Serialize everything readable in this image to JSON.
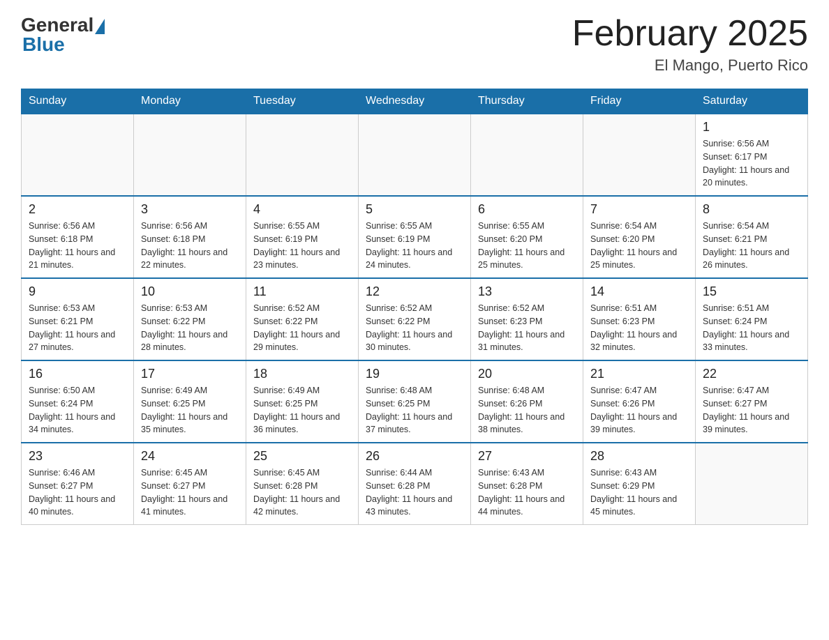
{
  "header": {
    "logo": {
      "text_general": "General",
      "text_blue": "Blue"
    },
    "title": "February 2025",
    "location": "El Mango, Puerto Rico"
  },
  "days_of_week": [
    "Sunday",
    "Monday",
    "Tuesday",
    "Wednesday",
    "Thursday",
    "Friday",
    "Saturday"
  ],
  "weeks": [
    [
      {
        "day": "",
        "info": ""
      },
      {
        "day": "",
        "info": ""
      },
      {
        "day": "",
        "info": ""
      },
      {
        "day": "",
        "info": ""
      },
      {
        "day": "",
        "info": ""
      },
      {
        "day": "",
        "info": ""
      },
      {
        "day": "1",
        "info": "Sunrise: 6:56 AM\nSunset: 6:17 PM\nDaylight: 11 hours and 20 minutes."
      }
    ],
    [
      {
        "day": "2",
        "info": "Sunrise: 6:56 AM\nSunset: 6:18 PM\nDaylight: 11 hours and 21 minutes."
      },
      {
        "day": "3",
        "info": "Sunrise: 6:56 AM\nSunset: 6:18 PM\nDaylight: 11 hours and 22 minutes."
      },
      {
        "day": "4",
        "info": "Sunrise: 6:55 AM\nSunset: 6:19 PM\nDaylight: 11 hours and 23 minutes."
      },
      {
        "day": "5",
        "info": "Sunrise: 6:55 AM\nSunset: 6:19 PM\nDaylight: 11 hours and 24 minutes."
      },
      {
        "day": "6",
        "info": "Sunrise: 6:55 AM\nSunset: 6:20 PM\nDaylight: 11 hours and 25 minutes."
      },
      {
        "day": "7",
        "info": "Sunrise: 6:54 AM\nSunset: 6:20 PM\nDaylight: 11 hours and 25 minutes."
      },
      {
        "day": "8",
        "info": "Sunrise: 6:54 AM\nSunset: 6:21 PM\nDaylight: 11 hours and 26 minutes."
      }
    ],
    [
      {
        "day": "9",
        "info": "Sunrise: 6:53 AM\nSunset: 6:21 PM\nDaylight: 11 hours and 27 minutes."
      },
      {
        "day": "10",
        "info": "Sunrise: 6:53 AM\nSunset: 6:22 PM\nDaylight: 11 hours and 28 minutes."
      },
      {
        "day": "11",
        "info": "Sunrise: 6:52 AM\nSunset: 6:22 PM\nDaylight: 11 hours and 29 minutes."
      },
      {
        "day": "12",
        "info": "Sunrise: 6:52 AM\nSunset: 6:22 PM\nDaylight: 11 hours and 30 minutes."
      },
      {
        "day": "13",
        "info": "Sunrise: 6:52 AM\nSunset: 6:23 PM\nDaylight: 11 hours and 31 minutes."
      },
      {
        "day": "14",
        "info": "Sunrise: 6:51 AM\nSunset: 6:23 PM\nDaylight: 11 hours and 32 minutes."
      },
      {
        "day": "15",
        "info": "Sunrise: 6:51 AM\nSunset: 6:24 PM\nDaylight: 11 hours and 33 minutes."
      }
    ],
    [
      {
        "day": "16",
        "info": "Sunrise: 6:50 AM\nSunset: 6:24 PM\nDaylight: 11 hours and 34 minutes."
      },
      {
        "day": "17",
        "info": "Sunrise: 6:49 AM\nSunset: 6:25 PM\nDaylight: 11 hours and 35 minutes."
      },
      {
        "day": "18",
        "info": "Sunrise: 6:49 AM\nSunset: 6:25 PM\nDaylight: 11 hours and 36 minutes."
      },
      {
        "day": "19",
        "info": "Sunrise: 6:48 AM\nSunset: 6:25 PM\nDaylight: 11 hours and 37 minutes."
      },
      {
        "day": "20",
        "info": "Sunrise: 6:48 AM\nSunset: 6:26 PM\nDaylight: 11 hours and 38 minutes."
      },
      {
        "day": "21",
        "info": "Sunrise: 6:47 AM\nSunset: 6:26 PM\nDaylight: 11 hours and 39 minutes."
      },
      {
        "day": "22",
        "info": "Sunrise: 6:47 AM\nSunset: 6:27 PM\nDaylight: 11 hours and 39 minutes."
      }
    ],
    [
      {
        "day": "23",
        "info": "Sunrise: 6:46 AM\nSunset: 6:27 PM\nDaylight: 11 hours and 40 minutes."
      },
      {
        "day": "24",
        "info": "Sunrise: 6:45 AM\nSunset: 6:27 PM\nDaylight: 11 hours and 41 minutes."
      },
      {
        "day": "25",
        "info": "Sunrise: 6:45 AM\nSunset: 6:28 PM\nDaylight: 11 hours and 42 minutes."
      },
      {
        "day": "26",
        "info": "Sunrise: 6:44 AM\nSunset: 6:28 PM\nDaylight: 11 hours and 43 minutes."
      },
      {
        "day": "27",
        "info": "Sunrise: 6:43 AM\nSunset: 6:28 PM\nDaylight: 11 hours and 44 minutes."
      },
      {
        "day": "28",
        "info": "Sunrise: 6:43 AM\nSunset: 6:29 PM\nDaylight: 11 hours and 45 minutes."
      },
      {
        "day": "",
        "info": ""
      }
    ]
  ]
}
